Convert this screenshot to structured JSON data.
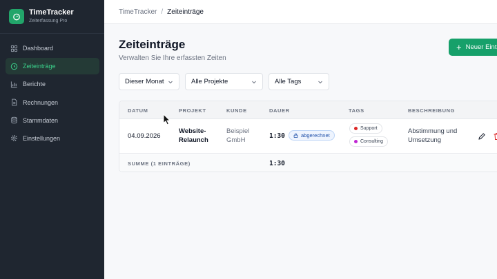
{
  "brand": {
    "name": "TimeTracker",
    "subtitle": "Zeiterfassung Pro",
    "color": "#22a56a"
  },
  "sidebar": {
    "items": [
      {
        "label": "Dashboard",
        "icon": "dashboard-icon",
        "active": false
      },
      {
        "label": "Zeiteinträge",
        "icon": "clock-icon",
        "active": true
      },
      {
        "label": "Berichte",
        "icon": "bar-chart-icon",
        "active": false
      },
      {
        "label": "Rechnungen",
        "icon": "document-icon",
        "active": false
      },
      {
        "label": "Stammdaten",
        "icon": "database-icon",
        "active": false
      },
      {
        "label": "Einstellungen",
        "icon": "gear-icon",
        "active": false
      }
    ]
  },
  "breadcrumb": {
    "root": "TimeTracker",
    "separator": "/",
    "current": "Zeiteinträge"
  },
  "header": {
    "title": "Zeiteinträge",
    "subtitle": "Verwalten Sie Ihre erfassten Zeiten",
    "new_button": "Neuer Eintr"
  },
  "filters": {
    "period": "Dieser Monat",
    "project": "Alle Projekte",
    "tags": "Alle Tags"
  },
  "table": {
    "columns": [
      "DATUM",
      "PROJEKT",
      "KUNDE",
      "DAUER",
      "TAGS",
      "BESCHREIBUNG"
    ],
    "rows": [
      {
        "date": "04.09.2026",
        "project_line1": "Website-",
        "project_line2": "Relaunch",
        "client_line1": "Beispiel",
        "client_line2": "GmbH",
        "duration": "1:30",
        "status": "abgerechnet",
        "tags": [
          {
            "label": "Support",
            "color": "#dc2626"
          },
          {
            "label": "Consulting",
            "color": "#c026d3"
          }
        ],
        "description_line1": "Abstimmung und",
        "description_line2": "Umsetzung"
      }
    ],
    "footer": {
      "label": "SUMME (1 EINTRÄGE)",
      "total": "1:30"
    }
  },
  "colors": {
    "accent": "#16a06a",
    "sidebar_bg": "#1f2630",
    "active_text": "#3ad08a",
    "delete": "#dc2626"
  }
}
